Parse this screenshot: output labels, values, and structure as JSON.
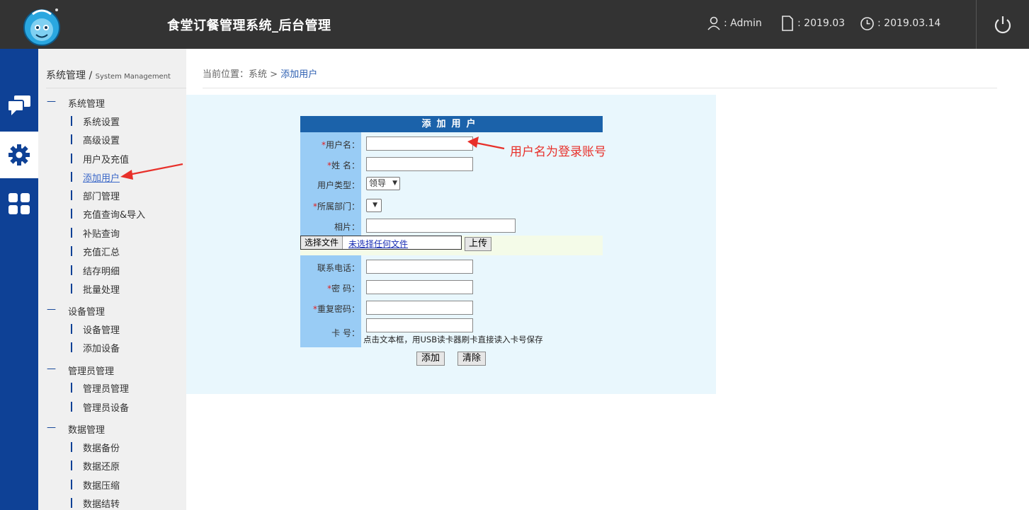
{
  "header": {
    "app_title": "食堂订餐管理系统_后台管理",
    "user": "Admin",
    "version": "2019.03",
    "date": "2019.03.14",
    "sep": ":"
  },
  "sidebar": {
    "title": "系统管理",
    "title_sep": " / ",
    "subtitle": "System Management",
    "groups": [
      {
        "label": "系统管理",
        "items": [
          "系统设置",
          "高级设置",
          "用户及充值",
          "添加用户",
          "部门管理",
          "充值查询&导入",
          "补贴查询",
          "充值汇总",
          "结存明细",
          "批量处理"
        ]
      },
      {
        "label": "设备管理",
        "items": [
          "设备管理",
          "添加设备"
        ]
      },
      {
        "label": "管理员管理",
        "items": [
          "管理员管理",
          "管理员设备"
        ]
      },
      {
        "label": "数据管理",
        "items": [
          "数据备份",
          "数据还原",
          "数据压缩",
          "数据结转"
        ]
      }
    ],
    "dash": "—"
  },
  "breadcrumb": {
    "prefix": "当前位置：系统",
    "sep": " > ",
    "current": "添加用户"
  },
  "form": {
    "title": "添加用户",
    "fields": {
      "username": "用户名：",
      "name": "姓 名：",
      "user_type": "用户类型：",
      "department": "所属部门：",
      "photo": "相片：",
      "phone": "联系电话：",
      "password": "密 码：",
      "repeat_password": "重复密码：",
      "card_no": "卡 号："
    },
    "required_mark": "*",
    "user_type_value": "领导",
    "department_value": "",
    "file_button": "选择文件",
    "file_status": "未选择任何文件",
    "upload_button": "上传",
    "card_hint": "点击文本框，用USB读卡器刷卡直接读入卡号保存",
    "add_button": "添加",
    "clear_button": "清除"
  },
  "annotation": {
    "text": "用户名为登录账号",
    "color": "#e8302a"
  },
  "colors": {
    "topbar": "#333333",
    "rail": "#0e4196",
    "form_header": "#1b62aa",
    "label_column": "#99ccf5",
    "panel": "#e9f7fd"
  }
}
